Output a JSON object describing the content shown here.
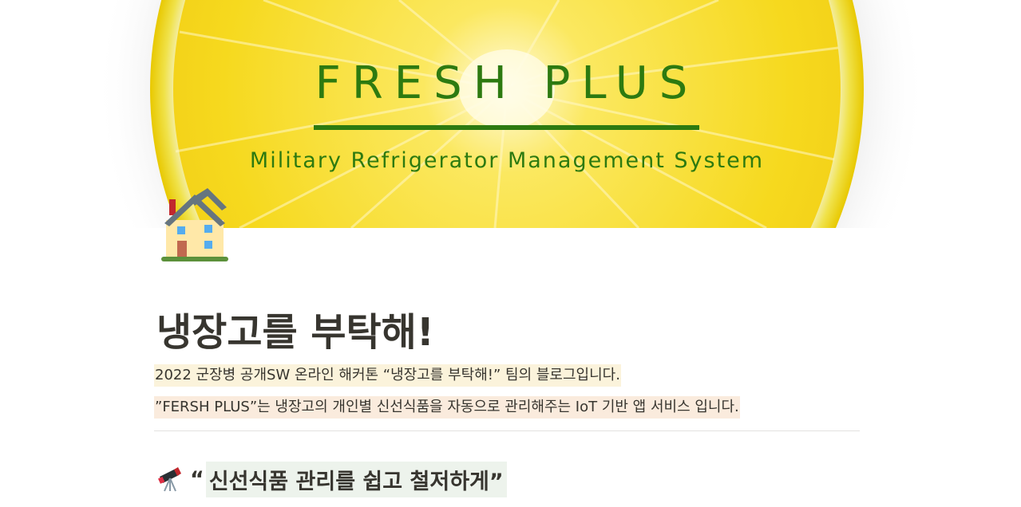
{
  "cover": {
    "title": "FRESH PLUS",
    "subtitle": "Military Refrigerator Management System",
    "image": "lemon-slice",
    "accent_color": "#2d7a10"
  },
  "page_icon": "house-icon",
  "page": {
    "title": "냉장고를 부탁해!"
  },
  "intro": {
    "line1": "2022 군장병 공개SW 온라인 해커톤 “냉장고를 부탁해!” 팀의 블로그입니다.",
    "line1_bg": "#fbf3db",
    "line2": "”FERSH PLUS”는 냉장고의 개인별 신선식품을 자동으로 관리해주는 IoT 기반 앱 서비스 입니다.",
    "line2_bg": "#faebdd"
  },
  "section": {
    "icon": "telescope-icon",
    "open_quote": "“",
    "heading": "신선식품 관리를 쉽고 철저하게”",
    "heading_bg": "#edf3ec"
  }
}
